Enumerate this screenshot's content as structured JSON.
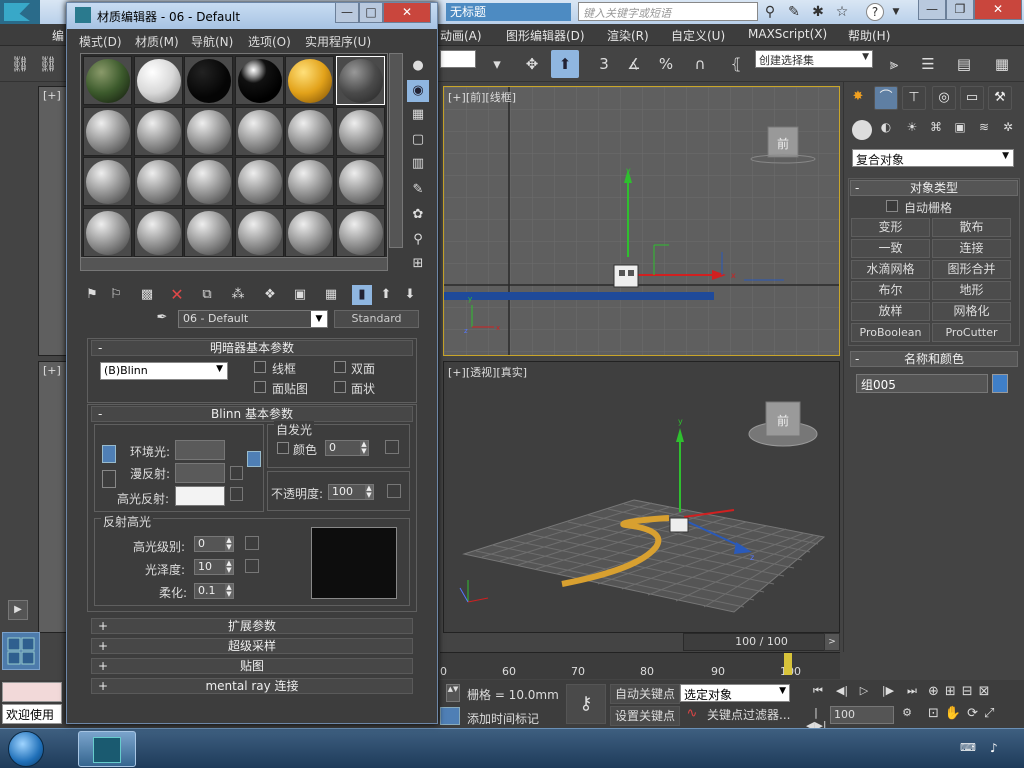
{
  "app": {
    "title": "无标题",
    "search_placeholder": "键入关键字或短语"
  },
  "menubar": [
    "编",
    "动画(A)",
    "图形编辑器(D)",
    "渲染(R)",
    "自定义(U)",
    "MAXScript(X)",
    "帮助(H)"
  ],
  "toolbar": {
    "selection_set": "创建选择集",
    "snap_label": "3",
    "percent_label": "%"
  },
  "viewports": {
    "front": {
      "label_plus": "[+]",
      "label_view": "[前]",
      "label_shade": "[线框]",
      "cube_label": "前"
    },
    "perspective": {
      "label_plus": "[+]",
      "label_view": "[透视]",
      "label_shade": "[真实]",
      "cube_label": "前"
    },
    "left_labels": [
      "[+]",
      "[+]"
    ]
  },
  "command_panel": {
    "category": "复合对象",
    "object_type_header": "对象类型",
    "auto_grid": "自动栅格",
    "buttons": [
      "变形",
      "散布",
      "一致",
      "连接",
      "水滴网格",
      "图形合并",
      "布尔",
      "地形",
      "放样",
      "网格化",
      "ProBoolean",
      "ProCutter"
    ],
    "name_color_header": "名称和颜色",
    "object_name": "组005",
    "object_color": "#3f7fc8"
  },
  "timeline": {
    "frame_display": "100 / 100",
    "ticks": [
      "0",
      "60",
      "70",
      "80",
      "90",
      "100"
    ]
  },
  "bottom": {
    "status_left": "欢迎使用",
    "grid": "栅格 = 10.0mm",
    "add_time_tag": "添加时间标记",
    "auto_key": "自动关键点",
    "set_key": "设置关键点",
    "selected_object": "选定对象",
    "key_filters": "关键点过滤器...",
    "frame_field": "100"
  },
  "material_editor": {
    "title": "材质编辑器 - 06 - Default",
    "menus": [
      "模式(D)",
      "材质(M)",
      "导航(N)",
      "选项(O)",
      "实用程序(U)"
    ],
    "material_name": "06 - Default",
    "material_type": "Standard",
    "shader_rollout": "明暗器基本参数",
    "shader_type": "(B)Blinn",
    "wire": "线框",
    "two_sided": "双面",
    "face_map": "面贴图",
    "faceted": "面状",
    "blinn_rollout": "Blinn 基本参数",
    "self_illum": "自发光",
    "color_label": "颜色",
    "self_illum_value": "0",
    "ambient": "环境光:",
    "diffuse": "漫反射:",
    "specular": "高光反射:",
    "opacity_label": "不透明度:",
    "opacity_value": "100",
    "spec_highlights": "反射高光",
    "spec_level_label": "高光级别:",
    "spec_level_value": "0",
    "gloss_label": "光泽度:",
    "gloss_value": "10",
    "soften_label": "柔化:",
    "soften_value": "0.1",
    "collapsed_rollouts": [
      "扩展参数",
      "超级采样",
      "贴图",
      "mental ray 连接"
    ],
    "slot_colors": [
      "camo",
      "white",
      "black",
      "black-chrome",
      "gold",
      "darkgray"
    ]
  }
}
